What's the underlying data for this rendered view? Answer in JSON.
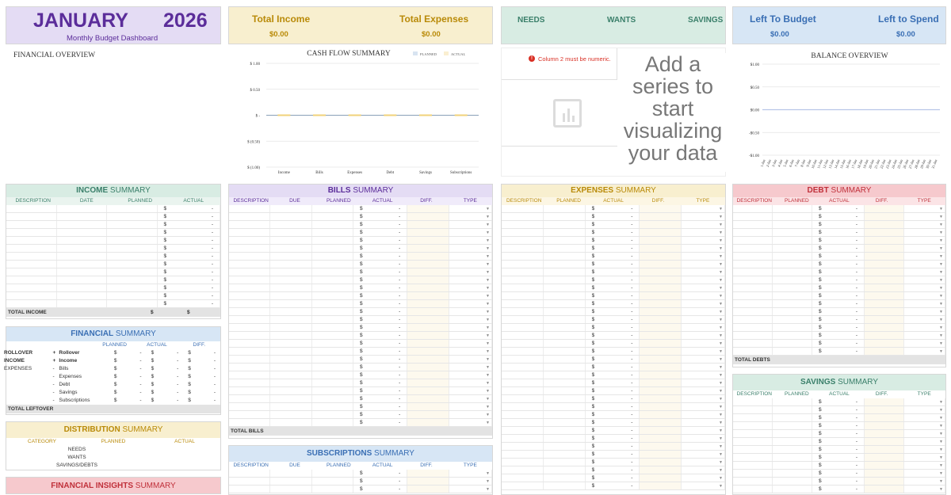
{
  "header": {
    "month": "JANUARY",
    "year": "2026",
    "subtitle": "Monthly Budget Dashboard"
  },
  "totals": {
    "income_label": "Total Income",
    "income_value": "$0.00",
    "expenses_label": "Total Expenses",
    "expenses_value": "$0.00"
  },
  "categories": {
    "needs": "NEEDS",
    "wants": "WANTS",
    "savings": "SAVINGS"
  },
  "budget": {
    "left_budget_label": "Left To Budget",
    "left_budget_value": "$0.00",
    "left_spend_label": "Left to Spend",
    "left_spend_value": "$0.00"
  },
  "financial_overview": {
    "title": "FINANCIAL OVERVIEW"
  },
  "pie_panel": {
    "error": "Column 2 must be numeric.",
    "placeholder": "Add a series to start visualizing your data"
  },
  "colors": {
    "purple": "#e4dcf4",
    "yellow": "#f8efcf",
    "green": "#d8ece3",
    "blue": "#d7e6f5",
    "pink": "#f6c9cd",
    "purple_text": "#5b2d9a",
    "yellow_text": "#b98a08",
    "green_text": "#3a7f6a",
    "blue_text": "#3a6fb4",
    "pink_text": "#c0303a"
  },
  "chart_data": [
    {
      "type": "line",
      "title": "CASH FLOW SUMMARY",
      "categories": [
        "Income",
        "Bills",
        "Expenses",
        "Debt",
        "Savings",
        "Subscriptions"
      ],
      "series": [
        {
          "name": "PLANNED",
          "values": [
            0,
            0,
            0,
            0,
            0,
            0
          ],
          "color": "#8fb1d6"
        },
        {
          "name": "ACTUAL",
          "values": [
            0,
            0,
            0,
            0,
            0,
            0
          ],
          "color": "#f0d27a"
        }
      ],
      "ylim": [
        -1,
        1
      ],
      "yticks": [
        "$ 1.00",
        "$ 0.50",
        "$ -",
        "$ (0.50)",
        "$ (1.00)"
      ],
      "grid": true,
      "legend": "top-right"
    },
    {
      "type": "line",
      "title": "BALANCE OVERVIEW",
      "categories": [
        "1-Jan",
        "2-Jan",
        "3-Jan",
        "4-Jan",
        "5-Jan",
        "6-Jan",
        "7-Jan",
        "8-Jan",
        "9-Jan",
        "10-Jan",
        "11-Jan",
        "12-Jan",
        "13-Jan",
        "14-Jan",
        "15-Jan",
        "16-Jan",
        "17-Jan",
        "18-Jan",
        "19-Jan",
        "20-Jan",
        "21-Jan",
        "22-Jan",
        "23-Jan",
        "24-Jan",
        "25-Jan",
        "26-Jan",
        "27-Jan",
        "28-Jan",
        "29-Jan",
        "30-Jan",
        "31-Jan"
      ],
      "series": [
        {
          "values": [
            0,
            0,
            0,
            0,
            0,
            0,
            0,
            0,
            0,
            0,
            0,
            0,
            0,
            0,
            0,
            0,
            0,
            0,
            0,
            0,
            0,
            0,
            0,
            0,
            0,
            0,
            0,
            0,
            0,
            0,
            0
          ],
          "color": "#b8c6e8"
        }
      ],
      "ylim": [
        -1,
        1
      ],
      "yticks": [
        "$1.00",
        "$0.50",
        "$0.00",
        "-$0.50",
        "-$1.00"
      ],
      "grid": true
    }
  ],
  "income_summary": {
    "title_bold": "INCOME",
    "title_rest": "SUMMARY",
    "columns": [
      "DESCRIPTION",
      "DATE",
      "PLANNED",
      "ACTUAL"
    ],
    "total_label": "TOTAL INCOME",
    "dollar": "$",
    "dash": "-"
  },
  "financial_summary": {
    "title_bold": "FINANCIAL",
    "title_rest": "SUMMARY",
    "columns": [
      "PLANNED",
      "ACTUAL",
      "DIFF."
    ],
    "rows": [
      {
        "cat": "ROLLOVER",
        "sign": "+",
        "item": "Rollover",
        "bold": true
      },
      {
        "cat": "INCOME",
        "sign": "+",
        "item": "Income",
        "bold": true
      },
      {
        "cat": "EXPENSES",
        "sign": "-",
        "item": "Bills",
        "bold": false
      },
      {
        "cat": "",
        "sign": "-",
        "item": "Expenses",
        "bold": false
      },
      {
        "cat": "",
        "sign": "-",
        "item": "Debt",
        "bold": false
      },
      {
        "cat": "",
        "sign": "-",
        "item": "Savings",
        "bold": false
      },
      {
        "cat": "",
        "sign": "-",
        "item": "Subscriptions",
        "bold": false
      }
    ],
    "total_label": "TOTAL LEFTOVER"
  },
  "distribution_summary": {
    "title_bold": "DISTRIBUTION",
    "title_rest": "SUMMARY",
    "columns": [
      "CATEGORY",
      "PLANNED",
      "ACTUAL"
    ],
    "rows": [
      "NEEDS",
      "WANTS",
      "SAVINGS/DEBTS"
    ]
  },
  "financial_insights": {
    "title_bold": "FINANCIAL INSIGHTS",
    "title_rest": "SUMMARY"
  },
  "bills_summary": {
    "title_bold": "BILLS",
    "title_rest": "SUMMARY",
    "columns": [
      "DESCRIPTION",
      "DUE",
      "PLANNED",
      "ACTUAL",
      "DIFF.",
      "TYPE"
    ],
    "total_label": "TOTAL BILLS"
  },
  "subscriptions_summary": {
    "title_bold": "SUBSCRIPTIONS",
    "title_rest": "SUMMARY",
    "columns": [
      "DESCRIPTION",
      "DUE",
      "PLANNED",
      "ACTUAL",
      "DIFF.",
      "TYPE"
    ]
  },
  "expenses_summary": {
    "title_bold": "EXPENSES",
    "title_rest": "SUMMARY",
    "columns": [
      "DESCRIPTION",
      "PLANNED",
      "ACTUAL",
      "DIFF.",
      "TYPE"
    ]
  },
  "debt_summary": {
    "title_bold": "DEBT",
    "title_rest": "SUMMARY",
    "columns": [
      "DESCRIPTION",
      "PLANNED",
      "ACTUAL",
      "DIFF.",
      "TYPE"
    ],
    "total_label": "TOTAL DEBTS"
  },
  "savings_summary": {
    "title_bold": "SAVINGS",
    "title_rest": "SUMMARY",
    "columns": [
      "DESCRIPTION",
      "PLANNED",
      "ACTUAL",
      "DIFF.",
      "TYPE"
    ]
  }
}
